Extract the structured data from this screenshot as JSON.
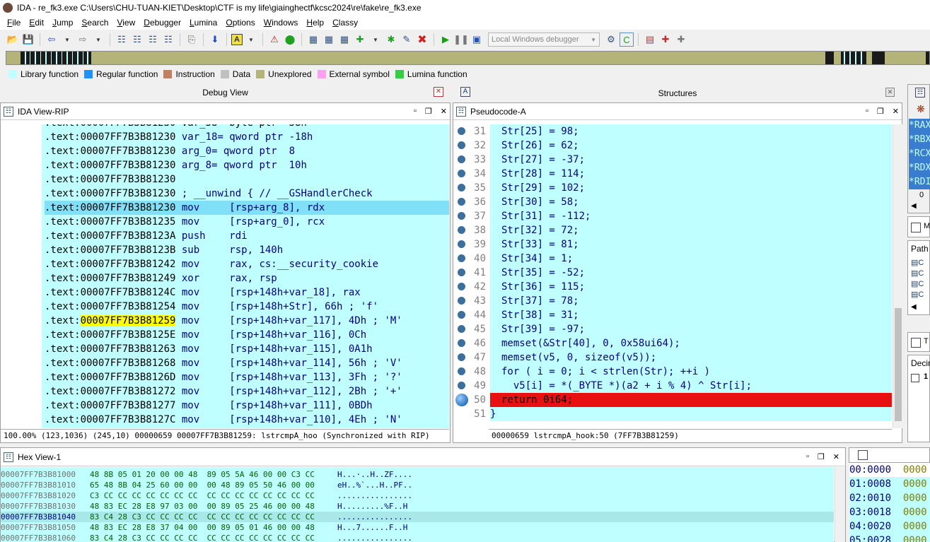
{
  "window": {
    "title": "IDA - re_fk3.exe C:\\Users\\CHU-TUAN-KIET\\Desktop\\CTF is my life\\giainghectf\\kcsc2024\\re\\fake\\re_fk3.exe"
  },
  "menu": [
    "File",
    "Edit",
    "Jump",
    "Search",
    "View",
    "Debugger",
    "Lumina",
    "Options",
    "Windows",
    "Help",
    "Classy"
  ],
  "toolbar": {
    "debugger_select": "Local Windows debugger"
  },
  "legend": [
    {
      "label": "Library function",
      "color": "#c0ffff"
    },
    {
      "label": "Regular function",
      "color": "#1e90ff"
    },
    {
      "label": "Instruction",
      "color": "#c08060"
    },
    {
      "label": "Data",
      "color": "#c0c0c0"
    },
    {
      "label": "Unexplored",
      "color": "#b4b478"
    },
    {
      "label": "External symbol",
      "color": "#ff9ff0"
    },
    {
      "label": "Lumina function",
      "color": "#30d040"
    }
  ],
  "debug_view": {
    "title": "Debug View"
  },
  "structures": {
    "title": "Structures"
  },
  "ida_view": {
    "title": "IDA View-RIP",
    "lines": [
      {
        "addr": ".text:00007FF7B3B81230",
        "text": " var_18= qword ptr -18h"
      },
      {
        "addr": ".text:00007FF7B3B81230",
        "text": " arg_0= qword ptr  8"
      },
      {
        "addr": ".text:00007FF7B3B81230",
        "text": " arg_8= qword ptr  10h"
      },
      {
        "addr": ".text:00007FF7B3B81230",
        "text": ""
      },
      {
        "addr": ".text:00007FF7B3B81230",
        "text": " ; __unwind { // __GSHandlerCheck"
      },
      {
        "addr": ".text:00007FF7B3B81230",
        "text": " mov     [rsp+arg_8], rdx"
      },
      {
        "addr": ".text:00007FF7B3B81235",
        "text": " mov     [rsp+arg_0], rcx"
      },
      {
        "addr": ".text:00007FF7B3B8123A",
        "text": " push    rdi"
      },
      {
        "addr": ".text:00007FF7B3B8123B",
        "text": " sub     rsp, 140h"
      },
      {
        "addr": ".text:00007FF7B3B81242",
        "text": " mov     rax, cs:__security_cookie"
      },
      {
        "addr": ".text:00007FF7B3B81249",
        "text": " xor     rax, rsp"
      },
      {
        "addr": ".text:00007FF7B3B8124C",
        "text": " mov     [rsp+148h+var_18], rax"
      },
      {
        "addr": ".text:00007FF7B3B81254",
        "text": " mov     [rsp+148h+Str], 66h ; 'f'"
      },
      {
        "addr": ".text:",
        "addr_hl": "00007FF7B3B81259",
        "text": " mov     [rsp+148h+var_117], 4Dh ; 'M'"
      },
      {
        "addr": ".text:00007FF7B3B8125E",
        "text": " mov     [rsp+148h+var_116], 0Ch"
      },
      {
        "addr": ".text:00007FF7B3B81263",
        "text": " mov     [rsp+148h+var_115], 0A1h"
      },
      {
        "addr": ".text:00007FF7B3B81268",
        "text": " mov     [rsp+148h+var_114], 56h ; 'V'"
      },
      {
        "addr": ".text:00007FF7B3B8126D",
        "text": " mov     [rsp+148h+var_113], 3Fh ; '?'"
      },
      {
        "addr": ".text:00007FF7B3B81272",
        "text": " mov     [rsp+148h+var_112], 2Bh ; '+'"
      },
      {
        "addr": ".text:00007FF7B3B81277",
        "text": " mov     [rsp+148h+var_111], 0BDh"
      },
      {
        "addr": ".text:00007FF7B3B8127C",
        "text": " mov     [rsp+148h+var_110], 4Eh ; 'N'"
      }
    ],
    "status": "100.00% (123,1036) (245,10) 00000659 00007FF7B3B81259: lstrcmpA_hoo (Synchronized with RIP)"
  },
  "pseudocode": {
    "title": "Pseudocode-A",
    "lines": [
      {
        "n": "31",
        "t": "Str[25] = 98;"
      },
      {
        "n": "32",
        "t": "Str[26] = 62;"
      },
      {
        "n": "33",
        "t": "Str[27] = -37;"
      },
      {
        "n": "34",
        "t": "Str[28] = 114;"
      },
      {
        "n": "35",
        "t": "Str[29] = 102;"
      },
      {
        "n": "36",
        "t": "Str[30] = 58;"
      },
      {
        "n": "37",
        "t": "Str[31] = -112;"
      },
      {
        "n": "38",
        "t": "Str[32] = 72;"
      },
      {
        "n": "39",
        "t": "Str[33] = 81;"
      },
      {
        "n": "40",
        "t": "Str[34] = 1;"
      },
      {
        "n": "41",
        "t": "Str[35] = -52;"
      },
      {
        "n": "42",
        "t": "Str[36] = 115;"
      },
      {
        "n": "43",
        "t": "Str[37] = 78;"
      },
      {
        "n": "44",
        "t": "Str[38] = 31;"
      },
      {
        "n": "45",
        "t": "Str[39] = -97;"
      },
      {
        "n": "46",
        "t": "memset(&Str[40], 0, 0x58ui64);"
      },
      {
        "n": "47",
        "t": "memset(v5, 0, sizeof(v5));"
      },
      {
        "n": "48",
        "t": "for ( i = 0; i < strlen(Str); ++i )"
      },
      {
        "n": "49",
        "t": "  v5[i] = *(_BYTE *)(a2 + i % 4) ^ Str[i];"
      },
      {
        "n": "50",
        "t": "return 0i64;"
      },
      {
        "n": "51",
        "t": "}"
      }
    ],
    "status": "00000659 lstrcmpA_hook:50 (7FF7B3B81259)"
  },
  "hex_view": {
    "title": "Hex View-1",
    "rows": [
      {
        "addr": "00007FF7B3B81000",
        "bytes": "48 8B 05 01 20 00 00 48  89 05 5A 46 00 00 C3 CC",
        "ascii": "H...·..H..ZF...."
      },
      {
        "addr": "00007FF7B3B81010",
        "bytes": "65 48 8B 04 25 60 00 00  00 48 89 05 50 46 00 00",
        "ascii": "eH..%`...H..PF.."
      },
      {
        "addr": "00007FF7B3B81020",
        "bytes": "C3 CC CC CC CC CC CC CC  CC CC CC CC CC CC CC CC",
        "ascii": "................"
      },
      {
        "addr": "00007FF7B3B81030",
        "bytes": "48 83 EC 28 E8 97 03 00  00 89 05 25 46 00 00 48",
        "ascii": "H.........%F..H"
      },
      {
        "addr": "00007FF7B3B81040",
        "bytes": "83 C4 28 C3 CC CC CC CC  CC CC CC CC CC CC CC CC",
        "ascii": "................"
      },
      {
        "addr": "00007FF7B3B81050",
        "bytes": "48 83 EC 28 E8 37 04 00  00 89 05 01 46 00 00 48",
        "ascii": "H...7......F..H"
      },
      {
        "addr": "00007FF7B3B81060",
        "bytes": "83 C4 28 C3 CC CC CC CC  CC CC CC CC CC CC CC CC",
        "ascii": "................"
      }
    ]
  },
  "registers": [
    "*RAX",
    "*RBX",
    "*RCX",
    "*RDX",
    "*RDI"
  ],
  "stack": [
    {
      "a": "00:0000",
      "v": "0000"
    },
    {
      "a": "01:0008",
      "v": "0000"
    },
    {
      "a": "02:0010",
      "v": "0000"
    },
    {
      "a": "03:0018",
      "v": "0000"
    },
    {
      "a": "04:0020",
      "v": "0000"
    },
    {
      "a": "05:0028",
      "v": "0000"
    }
  ],
  "side": {
    "path_label": "Path",
    "decimal_label": "Decim",
    "zero": "0",
    "m_label": "M",
    "t_label": "T",
    "one": "1"
  }
}
